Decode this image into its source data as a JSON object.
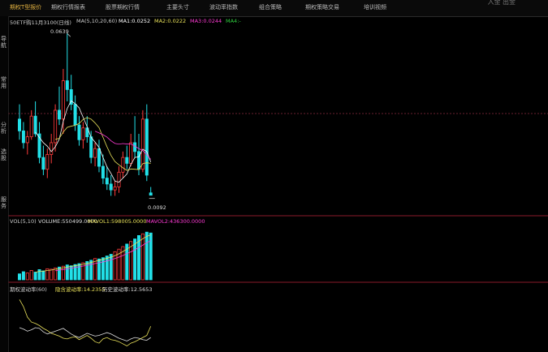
{
  "tabs": [
    {
      "label": "期权T型报价",
      "active": true
    },
    {
      "label": "期权行情报表",
      "active": false
    },
    {
      "label": "股票期权行情",
      "active": false
    },
    {
      "label": "主要头寸",
      "active": false
    },
    {
      "label": "波动率指数",
      "active": false
    },
    {
      "label": "组合策略",
      "active": false
    },
    {
      "label": "期权策略交易",
      "active": false
    },
    {
      "label": "培训视频",
      "active": false
    }
  ],
  "top_right_text": "入金 出金",
  "sidebar": [
    "导航",
    "常用",
    "分析",
    "选股",
    "服务"
  ],
  "price_panel": {
    "title": "50ETF购11月3100(日线)",
    "ma_label": "MA(5,10,20,60)",
    "ma1": "MA1:0.0252",
    "ma2": "MA2:0.0222",
    "ma3": "MA3:0.0244",
    "ma4": "MA4:-",
    "high_label": "0.0639",
    "low_label": "0.0092"
  },
  "vol_panel": {
    "title": "VOL(5,10)",
    "volume": "VOLUME:550499.0000",
    "mavol1": "MAVOL1:598005.0000",
    "mavol2": "MAVOL2:436300.0000"
  },
  "iv_panel": {
    "title": "期权波动率(60)",
    "implied": "隐含波动率:14.2355",
    "historical": "历史波动率:12.5653"
  },
  "colors": {
    "up": "#ff3b3b",
    "down": "#22e0e8",
    "ma1": "#ffffff",
    "ma2": "#e8e05a",
    "ma3": "#ff3bd5",
    "ma4": "#30d040",
    "panel_border": "#8a1a2a"
  },
  "chart_data": {
    "type": "candlestick",
    "candles": [
      [
        0.035,
        0.04,
        0.028,
        0.031
      ],
      [
        0.031,
        0.034,
        0.025,
        0.027
      ],
      [
        0.027,
        0.031,
        0.023,
        0.029
      ],
      [
        0.029,
        0.038,
        0.028,
        0.036
      ],
      [
        0.036,
        0.041,
        0.029,
        0.03
      ],
      [
        0.03,
        0.034,
        0.02,
        0.022
      ],
      [
        0.022,
        0.026,
        0.016,
        0.018
      ],
      [
        0.018,
        0.025,
        0.015,
        0.023
      ],
      [
        0.023,
        0.03,
        0.02,
        0.027
      ],
      [
        0.027,
        0.04,
        0.024,
        0.038
      ],
      [
        0.038,
        0.046,
        0.033,
        0.035
      ],
      [
        0.035,
        0.052,
        0.03,
        0.048
      ],
      [
        0.048,
        0.064,
        0.041,
        0.045
      ],
      [
        0.045,
        0.05,
        0.038,
        0.04
      ],
      [
        0.04,
        0.043,
        0.031,
        0.033
      ],
      [
        0.033,
        0.036,
        0.026,
        0.028
      ],
      [
        0.028,
        0.034,
        0.025,
        0.032
      ],
      [
        0.032,
        0.036,
        0.027,
        0.029
      ],
      [
        0.029,
        0.031,
        0.02,
        0.022
      ],
      [
        0.022,
        0.027,
        0.019,
        0.025
      ],
      [
        0.025,
        0.028,
        0.017,
        0.019
      ],
      [
        0.019,
        0.023,
        0.013,
        0.015
      ],
      [
        0.015,
        0.019,
        0.011,
        0.013
      ],
      [
        0.013,
        0.016,
        0.009,
        0.011
      ],
      [
        0.011,
        0.014,
        0.009,
        0.012
      ],
      [
        0.012,
        0.019,
        0.01,
        0.017
      ],
      [
        0.017,
        0.024,
        0.015,
        0.022
      ],
      [
        0.022,
        0.026,
        0.018,
        0.02
      ],
      [
        0.02,
        0.03,
        0.019,
        0.027
      ],
      [
        0.027,
        0.036,
        0.022,
        0.024
      ],
      [
        0.024,
        0.03,
        0.016,
        0.018
      ],
      [
        0.018,
        0.038,
        0.017,
        0.035
      ],
      [
        0.035,
        0.04,
        0.014,
        0.016
      ],
      [
        0.01,
        0.012,
        0.0092,
        0.0092
      ]
    ],
    "volume": [
      70,
      95,
      80,
      110,
      90,
      120,
      105,
      130,
      125,
      140,
      150,
      160,
      175,
      165,
      180,
      190,
      200,
      215,
      230,
      250,
      245,
      260,
      280,
      300,
      330,
      360,
      390,
      420,
      450,
      480,
      520,
      540,
      560,
      550
    ],
    "iv": [
      18,
      17,
      15.5,
      14.8,
      14.6,
      14.3,
      13.9,
      13.6,
      13.2,
      13.0,
      12.8,
      12.5,
      12.4,
      12.6,
      12.7,
      12.3,
      12.6,
      12.9,
      12.5,
      12.0,
      11.8,
      12.4,
      12.6,
      12.3,
      12.2,
      12.0,
      11.7,
      11.4,
      11.8,
      12.0,
      12.3,
      12.6,
      12.9,
      14.2
    ],
    "hv": [
      14,
      13.8,
      13.5,
      13.7,
      14.0,
      13.9,
      13.4,
      13.1,
      13.3,
      13.5,
      13.7,
      13.9,
      13.5,
      13.1,
      12.8,
      12.6,
      12.9,
      13.2,
      13.0,
      12.8,
      12.9,
      13.1,
      13.3,
      13.1,
      12.8,
      12.5,
      12.3,
      12.1,
      12.4,
      12.6,
      12.5,
      12.3,
      12.2,
      12.6
    ],
    "ylim": [
      0.005,
      0.066
    ]
  }
}
